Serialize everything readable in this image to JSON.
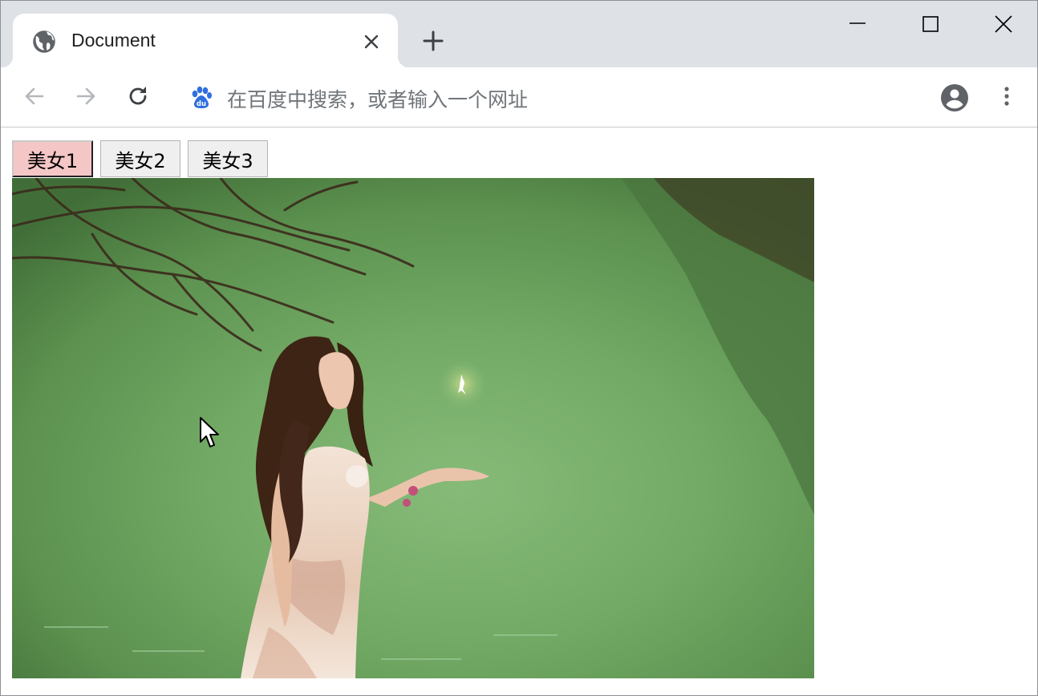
{
  "browser": {
    "tab_title": "Document",
    "omnibox_placeholder": "在百度中搜索，或者输入一个网址"
  },
  "page": {
    "buttons": [
      {
        "label": "美女1",
        "active": true
      },
      {
        "label": "美女2",
        "active": false
      },
      {
        "label": "美女3",
        "active": false
      }
    ]
  },
  "colors": {
    "active_button_bg": "#f5c6c6",
    "tabstrip_bg": "#dee1e6"
  },
  "icons": {
    "favicon": "globe-icon",
    "omnibox": "baidu-paw-icon"
  }
}
